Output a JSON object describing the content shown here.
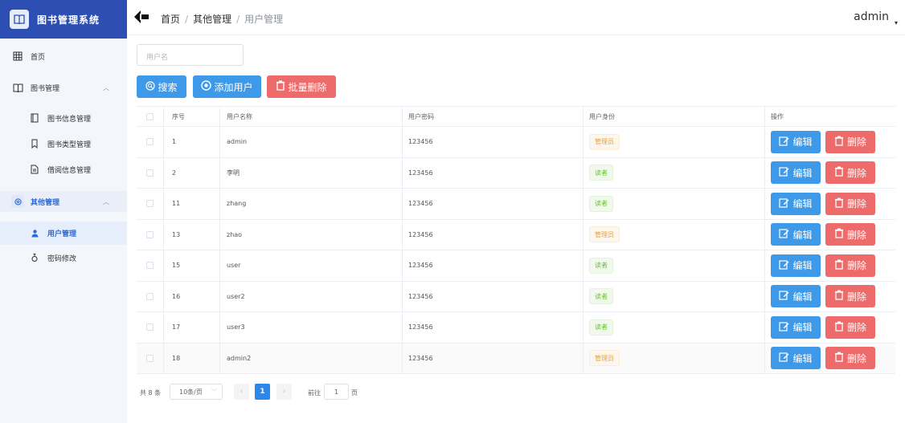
{
  "app": {
    "title": "图书管理系统"
  },
  "sidebar": {
    "items": [
      {
        "label": "首页",
        "icon": "grid-icon"
      },
      {
        "label": "图书管理",
        "icon": "book-icon",
        "expanded": true
      },
      {
        "label": "图书信息管理",
        "icon": "document-icon"
      },
      {
        "label": "图书类型管理",
        "icon": "bookmark-icon"
      },
      {
        "label": "借阅信息管理",
        "icon": "file-icon"
      },
      {
        "label": "其他管理",
        "icon": "settings-icon",
        "expanded": true
      },
      {
        "label": "用户管理",
        "icon": "user-icon",
        "active": true
      },
      {
        "label": "密码修改",
        "icon": "lock-icon"
      }
    ]
  },
  "header": {
    "breadcrumb": [
      "首页",
      "其他管理",
      "用户管理"
    ],
    "user": "admin"
  },
  "search": {
    "placeholder": "用户名"
  },
  "toolbar": {
    "search_label": "搜索",
    "add_label": "添加用户",
    "batch_delete_label": "批量删除"
  },
  "table": {
    "columns": [
      "序号",
      "用户名称",
      "用户密码",
      "用户身份",
      "操作"
    ],
    "rows": [
      {
        "id": "1",
        "name": "admin",
        "password": "123456",
        "role": "管理员"
      },
      {
        "id": "2",
        "name": "李明",
        "password": "123456",
        "role": "读者"
      },
      {
        "id": "11",
        "name": "zhang",
        "password": "123456",
        "role": "读者"
      },
      {
        "id": "13",
        "name": "zhao",
        "password": "123456",
        "role": "管理员"
      },
      {
        "id": "15",
        "name": "user",
        "password": "123456",
        "role": "读者"
      },
      {
        "id": "16",
        "name": "user2",
        "password": "123456",
        "role": "读者"
      },
      {
        "id": "17",
        "name": "user3",
        "password": "123456",
        "role": "读者"
      },
      {
        "id": "18",
        "name": "admin2",
        "password": "123456",
        "role": "管理员"
      }
    ],
    "edit_label": "编辑",
    "delete_label": "删除"
  },
  "pagination": {
    "total": "共 8 条",
    "page_size": "10条/页",
    "current_page": "1",
    "goto_prefix": "前往",
    "goto_value": "1",
    "goto_suffix": "页"
  },
  "colors": {
    "brand": "#2d4fb3",
    "primary": "#3e99e8",
    "danger": "#ee6b6b"
  }
}
